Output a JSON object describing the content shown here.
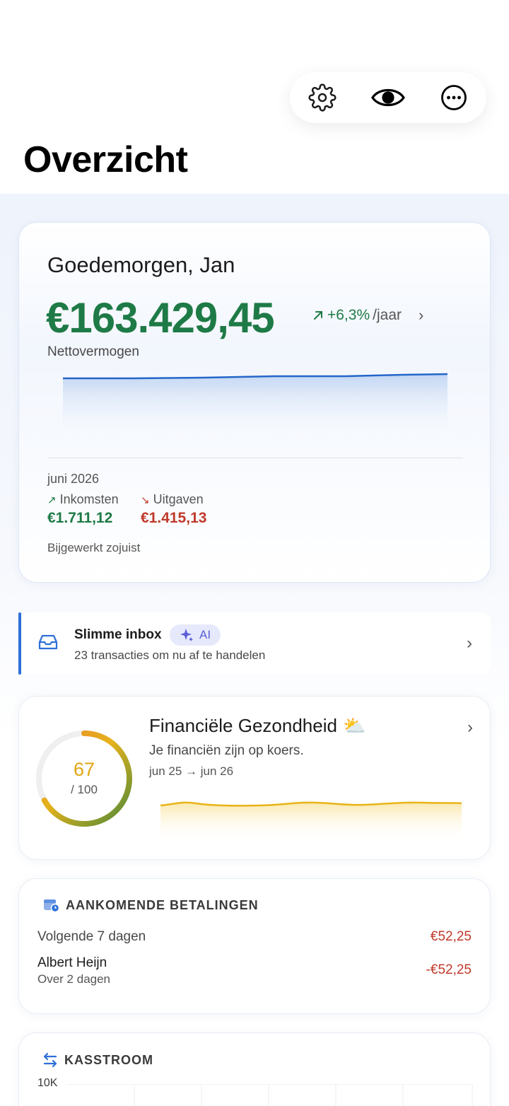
{
  "header": {
    "title": "Overzicht",
    "icons": [
      "gear-icon",
      "eye-icon",
      "more-icon"
    ]
  },
  "networth": {
    "greeting": "Goedemorgen, Jan",
    "amount": "€163.429,45",
    "growth": "+6,3%",
    "growth_unit": "/jaar",
    "label": "Nettovermogen",
    "month": "juni 2026",
    "income_label": "Inkomsten",
    "income_value": "€1.711,12",
    "expense_label": "Uitgaven",
    "expense_value": "€1.415,13",
    "updated": "Bijgewerkt zojuist",
    "accent_color": "#1e7a46",
    "line_color": "#2466c9"
  },
  "inbox": {
    "title": "Slimme inbox",
    "badge": "AI",
    "subtitle": "23 transacties om nu af te handelen"
  },
  "health": {
    "title": "Financiële Gezondheid",
    "emoji": "⛅",
    "subtitle": "Je financiën zijn op koers.",
    "range": "jun 25 → jun 26",
    "score": "67",
    "score_max": "/ 100",
    "score_value": 67
  },
  "upcoming": {
    "heading": "AANKOMENDE BETALINGEN",
    "period_label": "Volgende 7 dagen",
    "period_total": "€52,25",
    "items": [
      {
        "name": "Albert Heijn",
        "when": "Over 2 dagen",
        "amount": "-€52,25"
      }
    ]
  },
  "cashflow": {
    "heading": "KASSTROOM",
    "top_tick": "10K"
  }
}
